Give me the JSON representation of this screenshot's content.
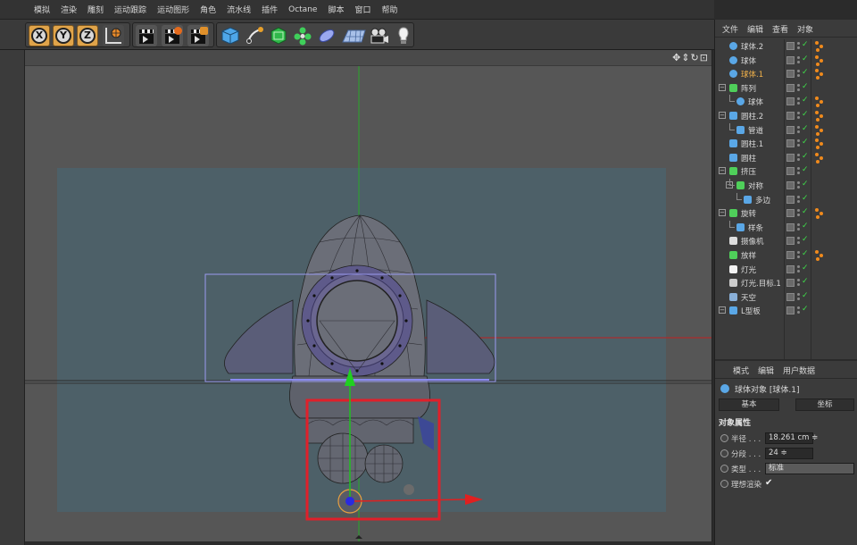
{
  "menu": [
    "模拟",
    "渲染",
    "雕刻",
    "运动跟踪",
    "运动图形",
    "角色",
    "流水线",
    "插件",
    "Octane",
    "脚本",
    "窗口",
    "帮助"
  ],
  "toolbar": {
    "axis_buttons": [
      "X",
      "Y",
      "Z"
    ],
    "icons": [
      "world-coordinate-icon",
      "render-view-icon",
      "render-picture-viewer-icon",
      "edit-render-settings-icon",
      "cube-icon",
      "pen-icon",
      "subdivision-icon",
      "cloner-icon",
      "deformer-icon",
      "floor-icon",
      "camera-icon",
      "light-icon"
    ]
  },
  "viewport": {
    "nav_icons": "✥⇕↻⊡",
    "colors": {
      "background": "#565656",
      "safe_frame": "#4d6068",
      "selection_box": "#e0202a",
      "x_axis": "#e02020",
      "y_axis": "#20c020"
    }
  },
  "object_manager": {
    "menu": [
      "文件",
      "编辑",
      "查看",
      "对象"
    ],
    "objects": [
      {
        "label": "球体.2",
        "indent": 0,
        "icon": "sphere-icon"
      },
      {
        "label": "球体",
        "indent": 0,
        "icon": "sphere-icon"
      },
      {
        "label": "球体.1",
        "indent": 0,
        "icon": "sphere-icon",
        "selected": true
      },
      {
        "label": "阵列",
        "indent": 0,
        "icon": "array-icon",
        "expanded": true
      },
      {
        "label": "球体",
        "indent": 1,
        "icon": "sphere-icon"
      },
      {
        "label": "圆柱.2",
        "indent": 0,
        "icon": "cylinder-icon",
        "expanded": true
      },
      {
        "label": "管道",
        "indent": 1,
        "icon": "tube-icon"
      },
      {
        "label": "圆柱.1",
        "indent": 0,
        "icon": "cylinder-icon"
      },
      {
        "label": "圆柱",
        "indent": 0,
        "icon": "cylinder-icon"
      },
      {
        "label": "挤压",
        "indent": 0,
        "icon": "extrude-icon",
        "expanded": true
      },
      {
        "label": "对称",
        "indent": 1,
        "icon": "symmetry-icon",
        "expanded": true
      },
      {
        "label": "多边",
        "indent": 2,
        "icon": "polygon-spline-icon"
      },
      {
        "label": "旋转",
        "indent": 0,
        "icon": "lathe-icon",
        "expanded": true
      },
      {
        "label": "样条",
        "indent": 1,
        "icon": "spline-icon"
      },
      {
        "label": "摄像机",
        "indent": 0,
        "icon": "camera-icon"
      },
      {
        "label": "放样",
        "indent": 0,
        "icon": "loft-icon"
      },
      {
        "label": "灯光",
        "indent": 0,
        "icon": "light-icon"
      },
      {
        "label": "灯光.目标.1",
        "indent": 0,
        "icon": "target-light-icon"
      },
      {
        "label": "天空",
        "indent": 0,
        "icon": "sky-icon"
      },
      {
        "label": "L型板",
        "indent": 0,
        "icon": "l-plate-icon",
        "expanded": true
      }
    ]
  },
  "attributes": {
    "menu": [
      "模式",
      "编辑",
      "用户数据"
    ],
    "title": "球体对象 [球体.1]",
    "tabs": [
      "基本",
      "坐标"
    ],
    "section": "对象属性",
    "params": [
      {
        "label": "半径 . . .",
        "value": "18.261 cm ≑"
      },
      {
        "label": "分段 . . .",
        "value": "24 ≑"
      },
      {
        "label": "类型 . . .",
        "value": "标准"
      },
      {
        "label": "理想渲染",
        "value": "✔"
      }
    ]
  }
}
